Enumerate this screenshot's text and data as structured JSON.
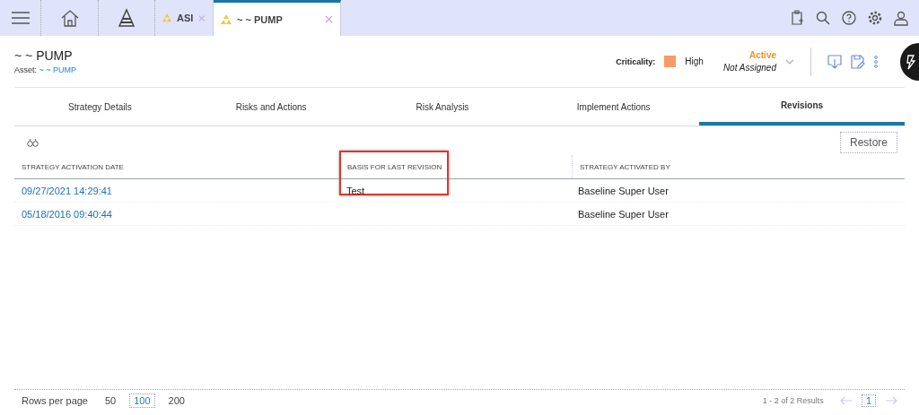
{
  "top_tabs": [
    {
      "label": "ASI",
      "selected": false
    },
    {
      "label": "~ ~ PUMP",
      "selected": true
    }
  ],
  "header": {
    "title": "~ ~ PUMP",
    "asset_label": "Asset:",
    "asset_link": "~ ~ PUMP",
    "criticality_label": "Criticality:",
    "criticality": "High",
    "status": "Active",
    "assignment": "Not Assigned"
  },
  "tabs": [
    {
      "label": "Strategy Details",
      "selected": false
    },
    {
      "label": "Risks and Actions",
      "selected": false
    },
    {
      "label": "Risk Analysis",
      "selected": false
    },
    {
      "label": "Implement Actions",
      "selected": false
    },
    {
      "label": "Revisions",
      "selected": true
    }
  ],
  "restore_button": "Restore",
  "table": {
    "columns": [
      {
        "label": "STRATEGY ACTIVATION DATE",
        "highlighted": false
      },
      {
        "label": "BASIS FOR LAST REVISION",
        "highlighted": true
      },
      {
        "label": "STRATEGY ACTIVATED BY",
        "highlighted": false
      }
    ],
    "rows": [
      [
        "09/27/2021 14:29:41",
        "Test",
        "Baseline Super User"
      ],
      [
        "05/18/2016 09:40:44",
        "",
        "Baseline Super User"
      ]
    ]
  },
  "footer": {
    "rows_per_page_label": "Rows per page",
    "page_sizes": [
      {
        "label": "50",
        "selected": false
      },
      {
        "label": "100",
        "selected": true
      },
      {
        "label": "200",
        "selected": false
      }
    ],
    "results": "1 - 2 of 2 Results",
    "page": "1"
  }
}
